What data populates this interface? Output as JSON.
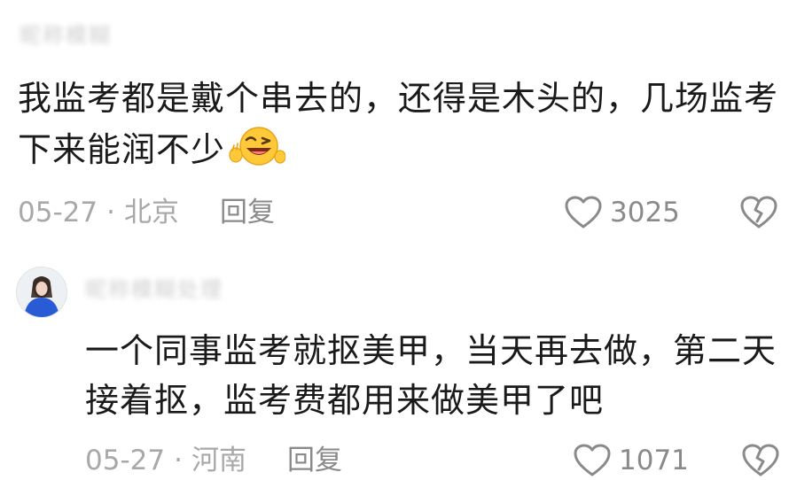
{
  "comment1": {
    "username": "昵称模糊",
    "text": "我监考都是戴个串去的，还得是木头的，几场监考下来能润不少",
    "emoji": "laughing-wink-emoji",
    "date": "05-27",
    "separator": "·",
    "location": "北京",
    "reply_label": "回复",
    "likes": "3025"
  },
  "comment2": {
    "username": "昵称模糊处理",
    "text": "一个同事监考就抠美甲，当天再去做，第二天接着抠，监考费都用来做美甲了吧",
    "date": "05-27",
    "separator": "·",
    "location": "河南",
    "reply_label": "回复",
    "likes": "1071"
  },
  "colors": {
    "text": "#1a1a1a",
    "meta": "#a8a8a8",
    "icon": "#8a8a8a",
    "avatar_shirt": "#2a5bd7"
  }
}
